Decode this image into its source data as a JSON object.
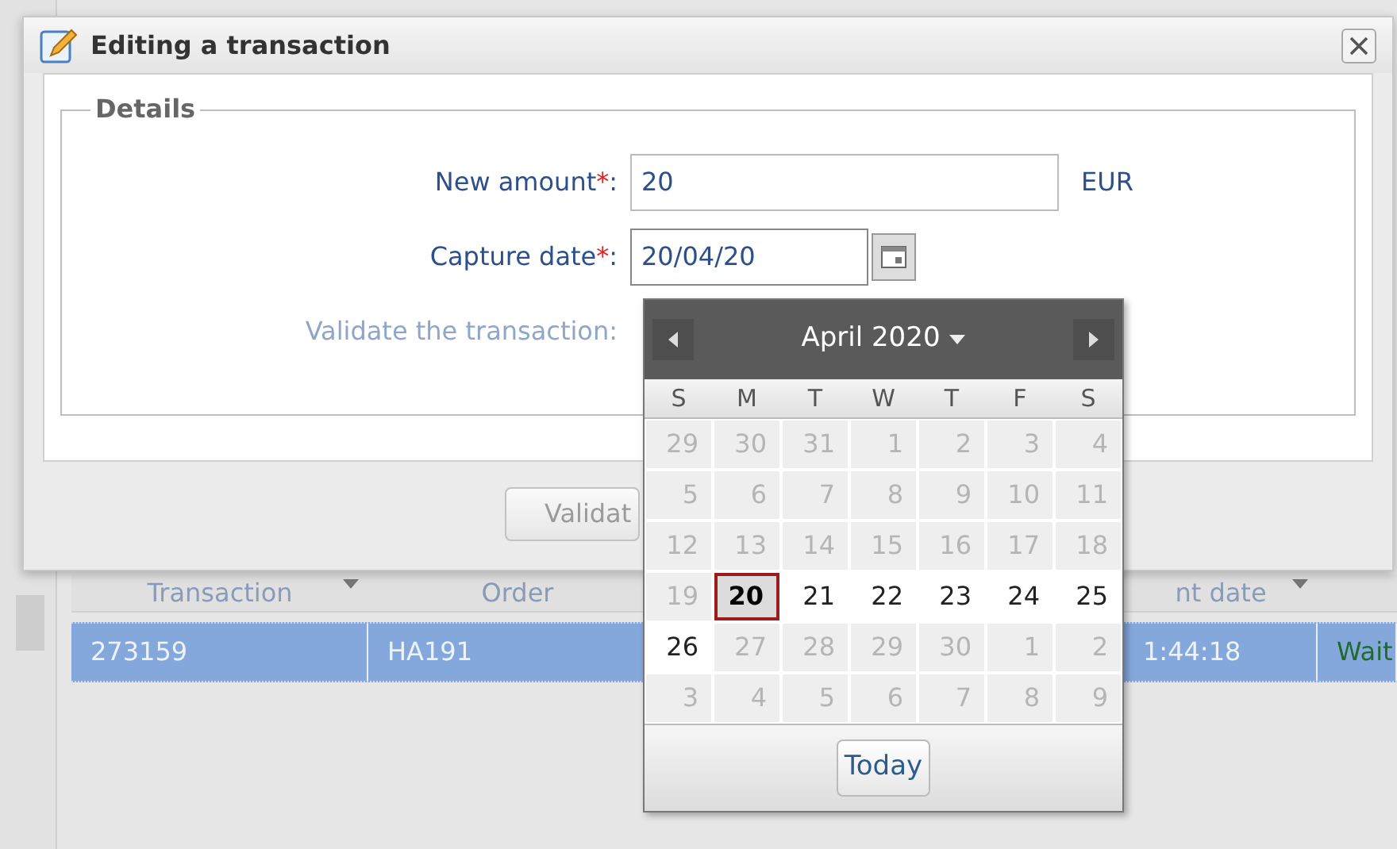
{
  "table": {
    "columns": [
      {
        "label": "Transaction",
        "sortable": true
      },
      {
        "label": "Order",
        "sortable": false
      },
      {
        "label": "nt date",
        "sortable": true
      }
    ],
    "rows": [
      {
        "selected": true,
        "cells": [
          {
            "text": "273159",
            "kind": "plain"
          },
          {
            "text": "HA191",
            "kind": "plain"
          },
          {
            "text": "1:44:18",
            "kind": "plain"
          },
          {
            "text": "Wait",
            "kind": "status"
          }
        ]
      }
    ]
  },
  "dialog": {
    "title": "Editing a transaction",
    "fieldset": "Details",
    "fields": [
      {
        "kind": "text",
        "label": "New amount",
        "mark": "*",
        "colon": ":",
        "value": "20",
        "unit": "EUR"
      },
      {
        "kind": "date",
        "label": "Capture date",
        "mark": "*",
        "colon": ":",
        "value": "20/04/20"
      }
    ],
    "validate_label": {
      "text": "Validate the transaction:",
      "disabled": true
    },
    "button": "Validat"
  },
  "calendar": {
    "month": "April 2020",
    "weekdays": [
      "S",
      "M",
      "T",
      "W",
      "T",
      "F",
      "S"
    ],
    "weeks": [
      [
        {
          "label": "29",
          "disabled": true,
          "selected": false
        },
        {
          "label": "30",
          "disabled": true,
          "selected": false
        },
        {
          "label": "31",
          "disabled": true,
          "selected": false
        },
        {
          "label": "1",
          "disabled": true,
          "selected": false
        },
        {
          "label": "2",
          "disabled": true,
          "selected": false
        },
        {
          "label": "3",
          "disabled": true,
          "selected": false
        },
        {
          "label": "4",
          "disabled": true,
          "selected": false
        }
      ],
      [
        {
          "label": "5",
          "disabled": true,
          "selected": false
        },
        {
          "label": "6",
          "disabled": true,
          "selected": false
        },
        {
          "label": "7",
          "disabled": true,
          "selected": false
        },
        {
          "label": "8",
          "disabled": true,
          "selected": false
        },
        {
          "label": "9",
          "disabled": true,
          "selected": false
        },
        {
          "label": "10",
          "disabled": true,
          "selected": false
        },
        {
          "label": "11",
          "disabled": true,
          "selected": false
        }
      ],
      [
        {
          "label": "12",
          "disabled": true,
          "selected": false
        },
        {
          "label": "13",
          "disabled": true,
          "selected": false
        },
        {
          "label": "14",
          "disabled": true,
          "selected": false
        },
        {
          "label": "15",
          "disabled": true,
          "selected": false
        },
        {
          "label": "16",
          "disabled": true,
          "selected": false
        },
        {
          "label": "17",
          "disabled": true,
          "selected": false
        },
        {
          "label": "18",
          "disabled": true,
          "selected": false
        }
      ],
      [
        {
          "label": "19",
          "disabled": true,
          "selected": false
        },
        {
          "label": "20",
          "disabled": false,
          "selected": true
        },
        {
          "label": "21",
          "disabled": false,
          "selected": false
        },
        {
          "label": "22",
          "disabled": false,
          "selected": false
        },
        {
          "label": "23",
          "disabled": false,
          "selected": false
        },
        {
          "label": "24",
          "disabled": false,
          "selected": false
        },
        {
          "label": "25",
          "disabled": false,
          "selected": false
        }
      ],
      [
        {
          "label": "26",
          "disabled": false,
          "selected": false
        },
        {
          "label": "27",
          "disabled": true,
          "selected": false
        },
        {
          "label": "28",
          "disabled": true,
          "selected": false
        },
        {
          "label": "29",
          "disabled": true,
          "selected": false
        },
        {
          "label": "30",
          "disabled": true,
          "selected": false
        },
        {
          "label": "1",
          "disabled": true,
          "selected": false
        },
        {
          "label": "2",
          "disabled": true,
          "selected": false
        }
      ],
      [
        {
          "label": "3",
          "disabled": true,
          "selected": false
        },
        {
          "label": "4",
          "disabled": true,
          "selected": false
        },
        {
          "label": "5",
          "disabled": true,
          "selected": false
        },
        {
          "label": "6",
          "disabled": true,
          "selected": false
        },
        {
          "label": "7",
          "disabled": true,
          "selected": false
        },
        {
          "label": "8",
          "disabled": true,
          "selected": false
        },
        {
          "label": "9",
          "disabled": true,
          "selected": false
        }
      ]
    ],
    "today_button": "Today"
  }
}
